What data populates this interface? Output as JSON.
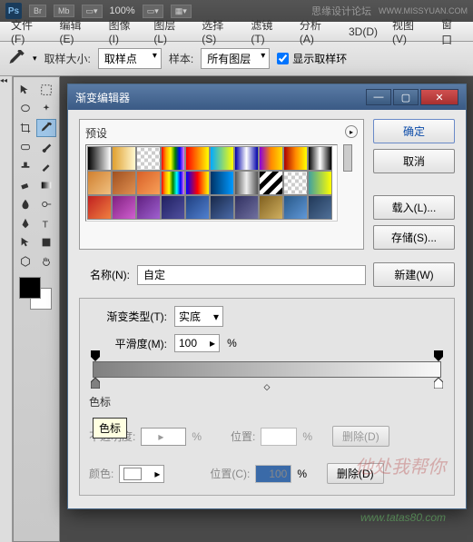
{
  "header": {
    "logo": "Ps",
    "btn_br": "Br",
    "btn_mb": "Mb",
    "zoom": "100%",
    "brand": "思缘设计论坛",
    "brand_url": "WWW.MISSYUAN.COM"
  },
  "menu": {
    "file": "文件(F)",
    "edit": "编辑(E)",
    "image": "图像(I)",
    "layer": "图层(L)",
    "select": "选择(S)",
    "filter": "滤镜(T)",
    "analysis": "分析(A)",
    "threeD": "3D(D)",
    "view": "视图(V)",
    "window": "窗口"
  },
  "options": {
    "sample_size_label": "取样大小:",
    "sample_size_value": "取样点",
    "sample_label": "样本:",
    "sample_value": "所有图层",
    "show_ring": "显示取样环"
  },
  "dialog": {
    "title": "渐变编辑器",
    "preset_label": "预设",
    "ok": "确定",
    "cancel": "取消",
    "load": "载入(L)...",
    "save": "存储(S)...",
    "new_btn": "新建(W)",
    "name_label": "名称(N):",
    "name_value": "自定",
    "type_label": "渐变类型(T):",
    "type_value": "实底",
    "smooth_label": "平滑度(M):",
    "smooth_value": "100",
    "percent": "%",
    "stops_section": "色标",
    "tooltip": "色标",
    "opacity_label": "不透明度:",
    "opacity_value": "",
    "pos1_label": "位置:",
    "pos1_value": "",
    "delete1": "删除(D)",
    "color_label": "颜色:",
    "pos2_label": "位置(C):",
    "pos2_value": "100",
    "delete2": "删除(D)"
  },
  "swatches": [
    "linear-gradient(90deg,#000,#fff)",
    "linear-gradient(90deg,#e0a030,#fff8d0)",
    "repeating-conic-gradient(#ccc 0 25%,#fff 0 50%) 0/8px 8px",
    "linear-gradient(90deg,red,orange,yellow,green,blue,violet)",
    "linear-gradient(90deg,red,#ff0)",
    "linear-gradient(90deg,#0af,#ff0)",
    "linear-gradient(90deg,#00a,#fff,#00a)",
    "linear-gradient(90deg,#80d,#f80,#fd0)",
    "linear-gradient(90deg,#a00,#f80,#ff0)",
    "linear-gradient(90deg,#000,#fff,#000)",
    "linear-gradient(135deg,#d08030,#f0c080)",
    "linear-gradient(135deg,#a05020,#e09050)",
    "linear-gradient(135deg,#d86028,#f8a058)",
    "linear-gradient(90deg,red,orange,yellow,green,cyan,blue,violet)",
    "linear-gradient(90deg,#00f,#f00,#ff0)",
    "linear-gradient(90deg,#036,#09f)",
    "linear-gradient(90deg,#555,#eee,#555)",
    "repeating-linear-gradient(135deg,#000 0 5px,#fff 5px 10px)",
    "repeating-conic-gradient(#ccc 0 25%,#fff 0 50%) 0/8px 8px",
    "linear-gradient(90deg,#40a0a0,#ff0)",
    "linear-gradient(135deg,#c02020,#f08040)",
    "linear-gradient(135deg,#802080,#d060d0)",
    "linear-gradient(135deg,#602080,#a060d0)",
    "linear-gradient(135deg,#202060,#5050a0)",
    "linear-gradient(135deg,#204080,#5080d0)",
    "linear-gradient(135deg,#182848,#4a6aa8)",
    "linear-gradient(135deg,#303060,#7070a0)",
    "linear-gradient(135deg,#806020,#d0b060)",
    "linear-gradient(135deg,#285888,#6098d8)",
    "linear-gradient(135deg,#203858,#507098)"
  ],
  "watermark": {
    "text1": "他处我帮你",
    "text2": "www.tatas80.com"
  }
}
